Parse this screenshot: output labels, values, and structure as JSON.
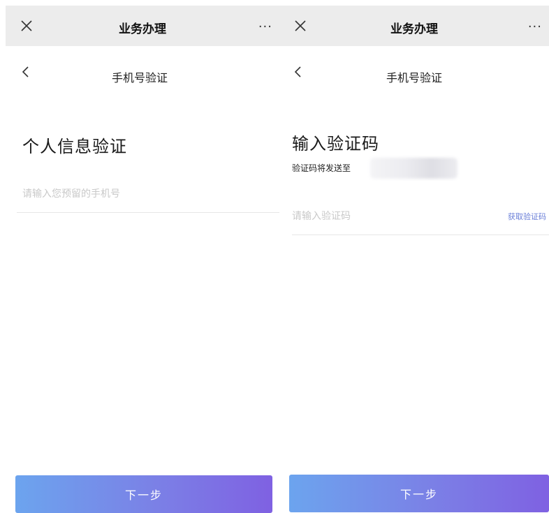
{
  "left_screen": {
    "topbar": {
      "close_icon": "close-icon",
      "title": "业务办理",
      "more": "···"
    },
    "navbar": {
      "back_icon": "chevron-left-icon",
      "title": "手机号验证"
    },
    "heading": "个人信息验证",
    "phone_input": {
      "value": "",
      "placeholder": "请输入您预留的手机号"
    },
    "next_button": "下一步"
  },
  "right_screen": {
    "topbar": {
      "close_icon": "close-icon",
      "title": "业务办理",
      "more": "···"
    },
    "navbar": {
      "back_icon": "chevron-left-icon",
      "title": "手机号验证"
    },
    "heading": "输入验证码",
    "subnote": "验证码将发送至",
    "code_input": {
      "value": "",
      "placeholder": "请输入验证码"
    },
    "get_code_link": "获取验证码",
    "next_button": "下一步"
  },
  "colors": {
    "button_gradient_start": "#6ca4ee",
    "button_gradient_end": "#7f61e2",
    "link": "#6a7fd8",
    "topbar_bg": "#ececec"
  }
}
